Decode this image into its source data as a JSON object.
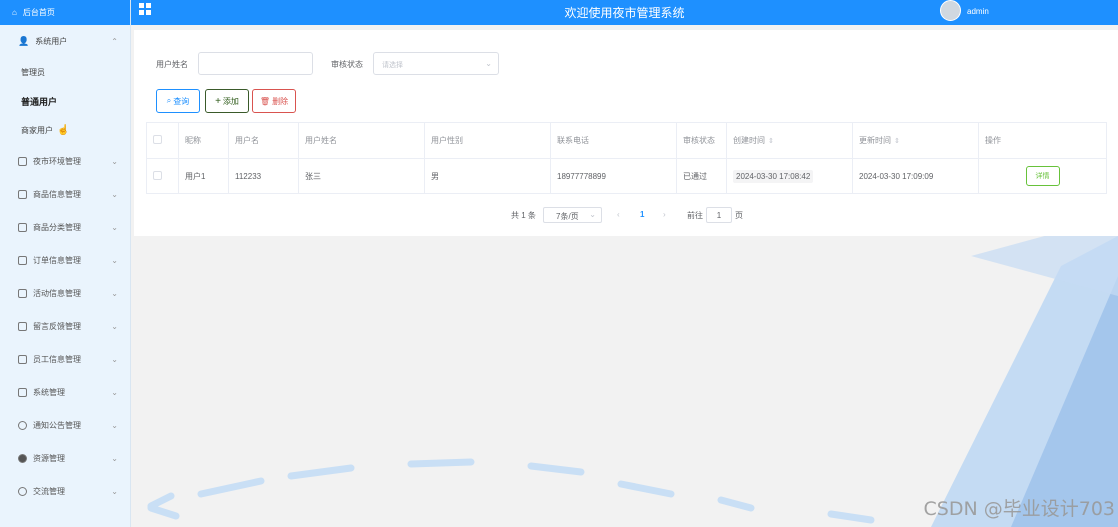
{
  "sidebar": {
    "header": "后台首页",
    "menus": [
      {
        "label": "系统用户",
        "icon": "user-icon",
        "expanded": true,
        "children": [
          {
            "label": "管理员"
          },
          {
            "label": "普通用户",
            "active": true
          },
          {
            "label": "商家用户"
          }
        ]
      },
      {
        "label": "夜市环境管理",
        "icon": "doc-icon"
      },
      {
        "label": "商品信息管理",
        "icon": "doc-icon"
      },
      {
        "label": "商品分类管理",
        "icon": "doc-icon"
      },
      {
        "label": "订单信息管理",
        "icon": "doc-icon"
      },
      {
        "label": "活动信息管理",
        "icon": "doc-icon"
      },
      {
        "label": "留言反馈管理",
        "icon": "doc-icon"
      },
      {
        "label": "员工信息管理",
        "icon": "doc-icon"
      },
      {
        "label": "系统管理",
        "icon": "image-icon"
      },
      {
        "label": "通知公告管理",
        "icon": "info-icon"
      },
      {
        "label": "资源管理",
        "icon": "pin-icon"
      },
      {
        "label": "交流管理",
        "icon": "chat-icon"
      }
    ]
  },
  "topbar": {
    "title": "欢迎使用夜市管理系统",
    "username": "admin"
  },
  "filters": {
    "name_label": "用户姓名",
    "name_value": "",
    "status_label": "审核状态",
    "status_placeholder": "请选择"
  },
  "buttons": {
    "query": "查询",
    "add": "添加",
    "delete": "删除"
  },
  "table": {
    "headers": [
      "昵称",
      "用户名",
      "用户姓名",
      "用户性别",
      "联系电话",
      "审核状态",
      "创建时间",
      "更新时间",
      "操作"
    ],
    "rows": [
      {
        "nickname": "用户1",
        "username": "112233",
        "realname": "张三",
        "gender": "男",
        "phone": "18977778899",
        "status": "已通过",
        "created": "2024-03-30 17:08:42",
        "updated": "2024-03-30 17:09:09",
        "action": "详情"
      }
    ]
  },
  "pagination": {
    "total": "共 1 条",
    "page_size": "7条/页",
    "current_page": "1",
    "goto_label": "前往",
    "goto_value": "1",
    "page_suffix": "页"
  },
  "watermark": "CSDN @毕业设计703",
  "colors": {
    "primary": "#1e90ff",
    "sidebar_bg": "#eaf4fd",
    "success": "#67c23a",
    "danger": "#d9534f"
  }
}
